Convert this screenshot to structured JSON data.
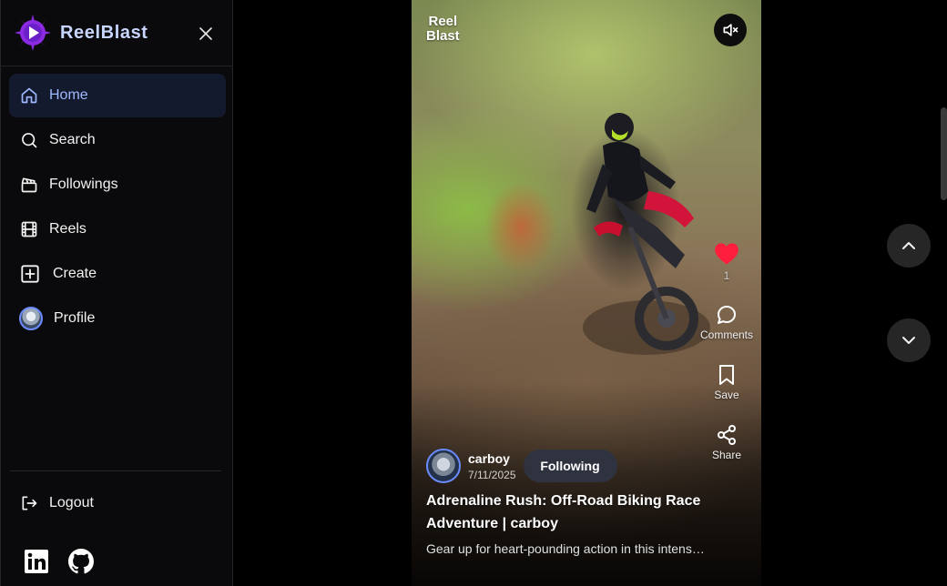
{
  "brand": {
    "name": "ReelBlast"
  },
  "nav": {
    "items": [
      {
        "label": "Home",
        "icon": "home-icon",
        "active": true
      },
      {
        "label": "Search",
        "icon": "search-icon"
      },
      {
        "label": "Followings",
        "icon": "clapperboard-icon"
      },
      {
        "label": "Reels",
        "icon": "film-icon"
      },
      {
        "label": "Create",
        "icon": "plus-square-icon"
      },
      {
        "label": "Profile",
        "icon": "avatar"
      }
    ],
    "logout": "Logout"
  },
  "video": {
    "watermark_line1": "Reel",
    "watermark_line2": "Blast",
    "muted": true,
    "likes": "1",
    "comments_label": "Comments",
    "save_label": "Save",
    "share_label": "Share",
    "author": {
      "name": "carboy",
      "date": "7/11/2025"
    },
    "follow_label": "Following",
    "title": "Adrenaline Rush: Off-Road Biking Race Adventure | carboy",
    "description": "Gear up for heart-pounding action in this intense off-road biking race adventure!"
  },
  "colors": {
    "accent": "#9fb9ff",
    "like": "#ff1f3d",
    "brand_purple": "#8a2be2"
  }
}
